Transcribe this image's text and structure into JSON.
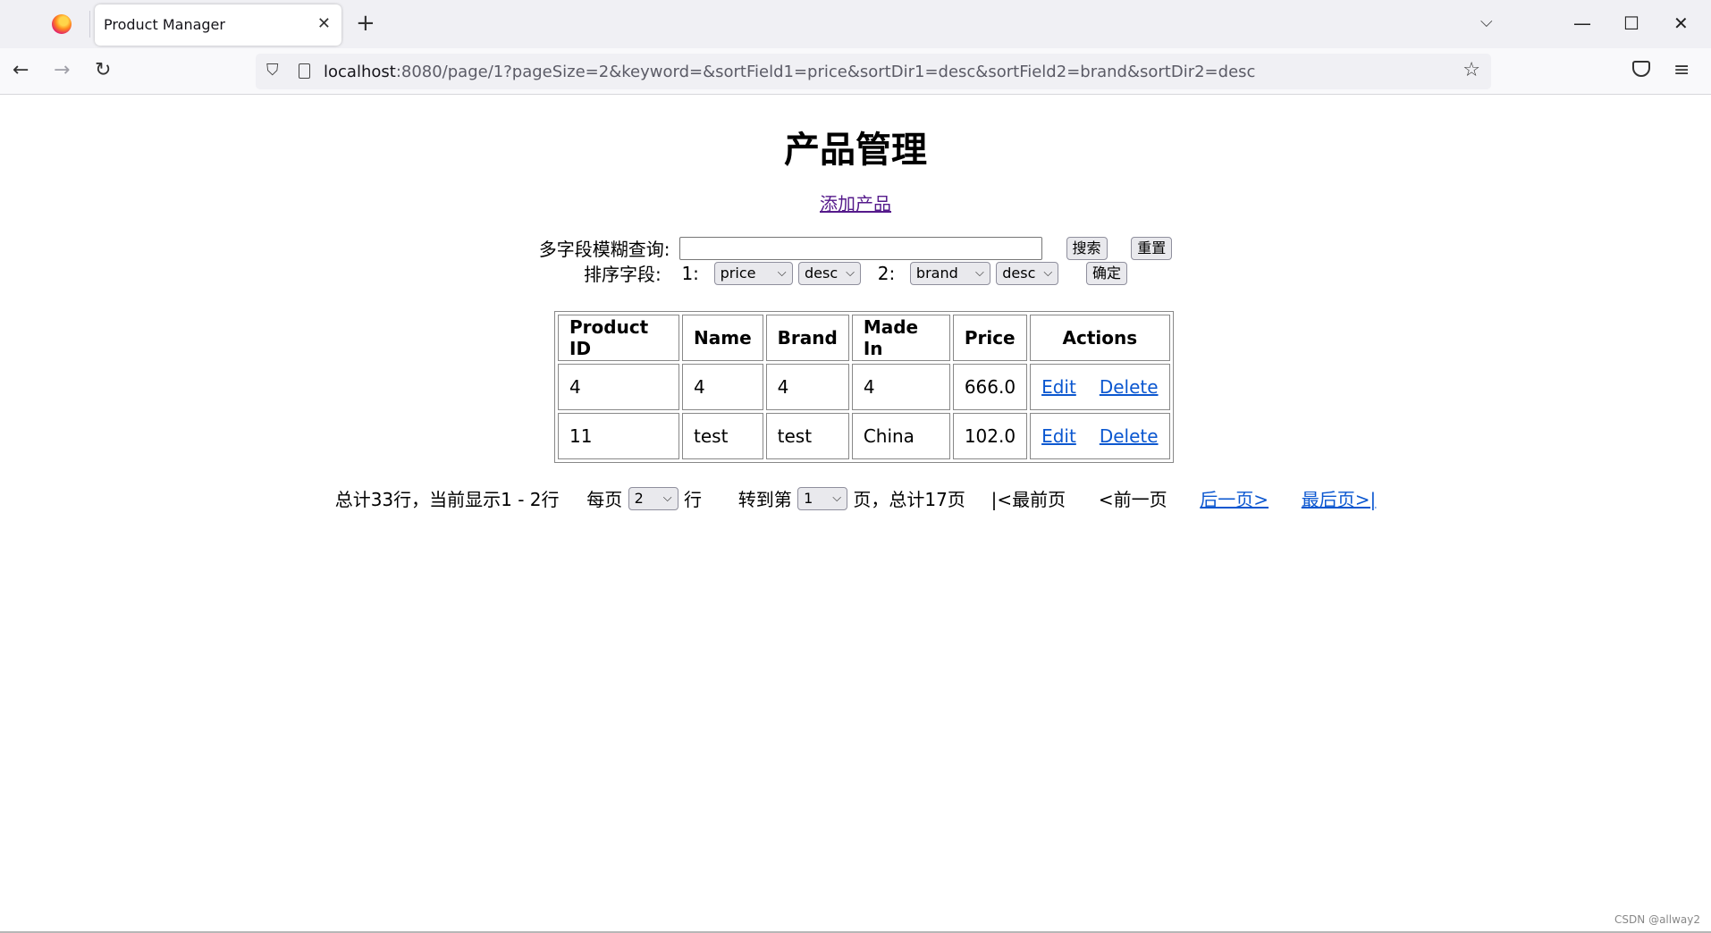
{
  "browser": {
    "tab_title": "Product Manager",
    "url_host": "localhost",
    "url_rest": ":8080/page/1?pageSize=2&keyword=&sortField1=price&sortDir1=desc&sortField2=brand&sortDir2=desc"
  },
  "page": {
    "title": "产品管理",
    "add_link": "添加产品"
  },
  "search": {
    "label": "多字段模糊查询:",
    "value": "",
    "search_button": "搜索",
    "reset_button": "重置"
  },
  "sort": {
    "label": "排序字段:",
    "field1_label": "1:",
    "field1": "price",
    "dir1": "desc",
    "field2_label": "2:",
    "field2": "brand",
    "dir2": "desc",
    "confirm_button": "确定"
  },
  "table": {
    "headers": [
      "Product ID",
      "Name",
      "Brand",
      "Made In",
      "Price",
      "Actions"
    ],
    "rows": [
      {
        "id": "4",
        "name": "4",
        "brand": "4",
        "made_in": "4",
        "price": "666.0",
        "edit": "Edit",
        "delete": "Delete"
      },
      {
        "id": "11",
        "name": "test",
        "brand": "test",
        "made_in": "China",
        "price": "102.0",
        "edit": "Edit",
        "delete": "Delete"
      }
    ]
  },
  "pager": {
    "summary": "总计33行，当前显示1 - 2行",
    "per_page_prefix": "每页",
    "page_size": "2",
    "per_page_suffix": "行",
    "goto_prefix": "转到第",
    "current_page": "1",
    "goto_suffix": "页，总计17页",
    "first": "|<最前页",
    "prev": "<前一页",
    "next": "后一页>",
    "last": "最后页>|"
  },
  "watermark": "CSDN @allway2"
}
